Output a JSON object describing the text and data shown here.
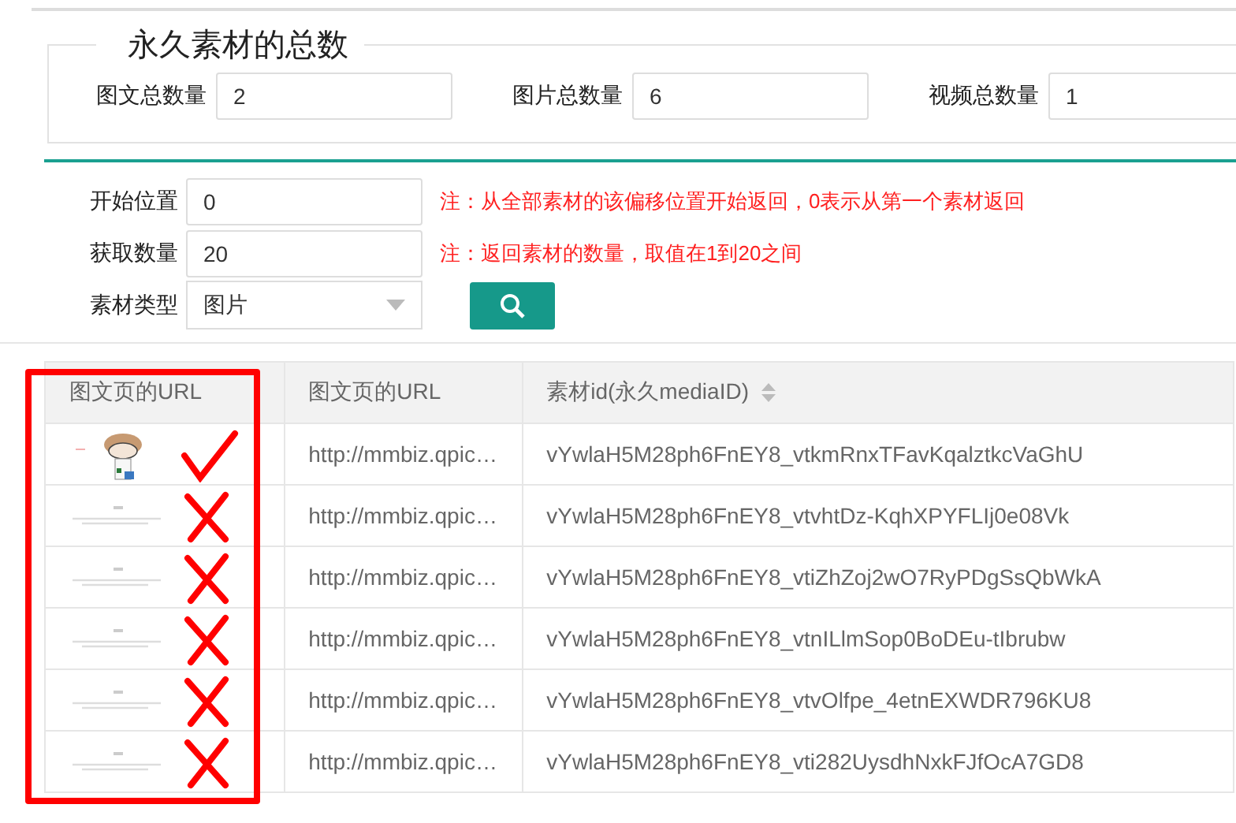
{
  "totals": {
    "legend": "永久素材的总数",
    "fields": [
      {
        "label": "图文总数量",
        "value": "2"
      },
      {
        "label": "图片总数量",
        "value": "6"
      },
      {
        "label": "视频总数量",
        "value": "1"
      }
    ]
  },
  "query": {
    "rows": [
      {
        "kind": "input",
        "label": "开始位置",
        "value": "0",
        "note": "注：从全部素材的该偏移位置开始返回，0表示从第一个素材返回"
      },
      {
        "kind": "input",
        "label": "获取数量",
        "value": "20",
        "note": "注：返回素材的数量，取值在1到20之间"
      },
      {
        "kind": "select",
        "label": "素材类型",
        "value": "图片"
      }
    ]
  },
  "table": {
    "columns": [
      {
        "label": "图文页的URL",
        "sortable": false
      },
      {
        "label": "图文页的URL",
        "sortable": false
      },
      {
        "label": "素材id(永久mediaID)",
        "sortable": true
      }
    ],
    "rows": [
      {
        "thumbnail": {
          "kind": "cartoon"
        },
        "url": "http://mmbiz.qpic…",
        "id": "vYwlaH5M28ph6FnEY8_vtkmRnxTFavKqalztkcVaGhU",
        "annotation": {
          "kind": "check"
        }
      },
      {
        "thumbnail": {
          "kind": "text"
        },
        "url": "http://mmbiz.qpic…",
        "id": "vYwlaH5M28ph6FnEY8_vtvhtDz-KqhXPYFLIj0e08Vk",
        "annotation": {
          "kind": "cross"
        }
      },
      {
        "thumbnail": {
          "kind": "text"
        },
        "url": "http://mmbiz.qpic…",
        "id": "vYwlaH5M28ph6FnEY8_vtiZhZoj2wO7RyPDgSsQbWkA",
        "annotation": {
          "kind": "cross"
        }
      },
      {
        "thumbnail": {
          "kind": "text"
        },
        "url": "http://mmbiz.qpic…",
        "id": "vYwlaH5M28ph6FnEY8_vtnILlmSop0BoDEu-tIbrubw",
        "annotation": {
          "kind": "cross"
        }
      },
      {
        "thumbnail": {
          "kind": "text"
        },
        "url": "http://mmbiz.qpic…",
        "id": "vYwlaH5M28ph6FnEY8_vtvOlfpe_4etnEXWDR796KU8",
        "annotation": {
          "kind": "cross"
        }
      },
      {
        "thumbnail": {
          "kind": "text"
        },
        "url": "http://mmbiz.qpic…",
        "id": "vYwlaH5M28ph6FnEY8_vti282UysdhNxkFJfOcA7GD8",
        "annotation": {
          "kind": "cross"
        }
      }
    ],
    "highlight": true
  }
}
